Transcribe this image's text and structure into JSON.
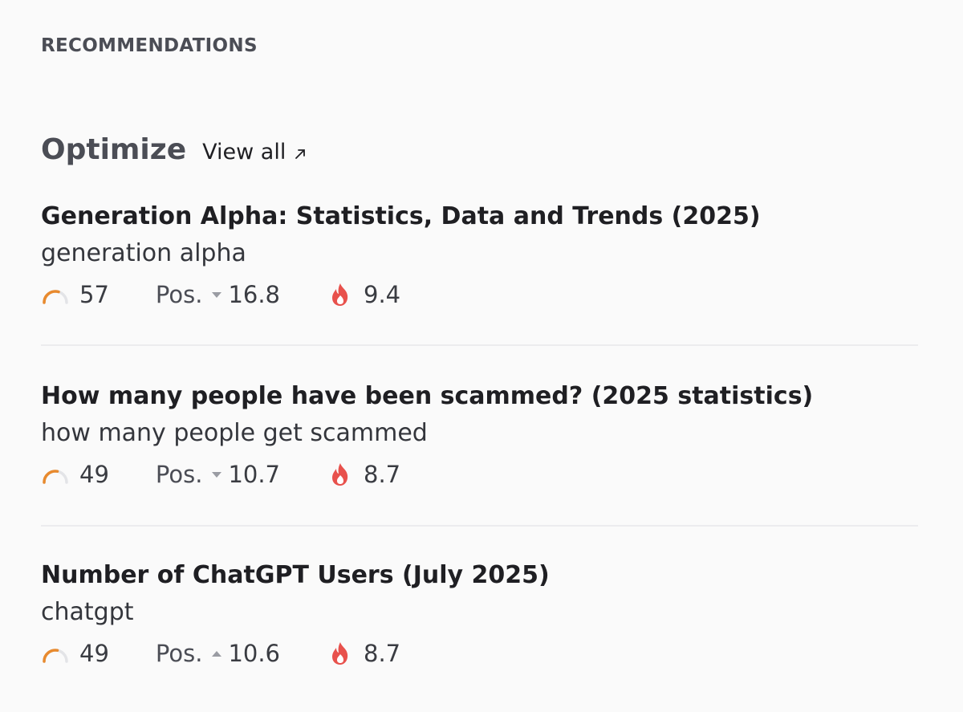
{
  "section": {
    "label": "RECOMMENDATIONS"
  },
  "group": {
    "title": "Optimize",
    "view_all": "View all",
    "view_all_icon": "external-arrow-icon"
  },
  "recommendations": [
    {
      "title": "Generation Alpha: Statistics, Data and Trends (2025)",
      "keyword": "generation alpha",
      "score": "57",
      "pos_label": "Pos.",
      "pos_trend": "down",
      "pos_value": "16.8",
      "traffic": "9.4"
    },
    {
      "title": "How many people have been scammed? (2025 statistics)",
      "keyword": "how many people get scammed",
      "score": "49",
      "pos_label": "Pos.",
      "pos_trend": "down",
      "pos_value": "10.7",
      "traffic": "8.7"
    },
    {
      "title": "Number of ChatGPT Users (July 2025)",
      "keyword": "chatgpt",
      "score": "49",
      "pos_label": "Pos.",
      "pos_trend": "up",
      "pos_value": "10.6",
      "traffic": "8.7"
    }
  ],
  "colors": {
    "gauge": "#e88a2e",
    "flame": "#e8514c",
    "caret": "#9a9ca3",
    "divider": "#ececee"
  }
}
